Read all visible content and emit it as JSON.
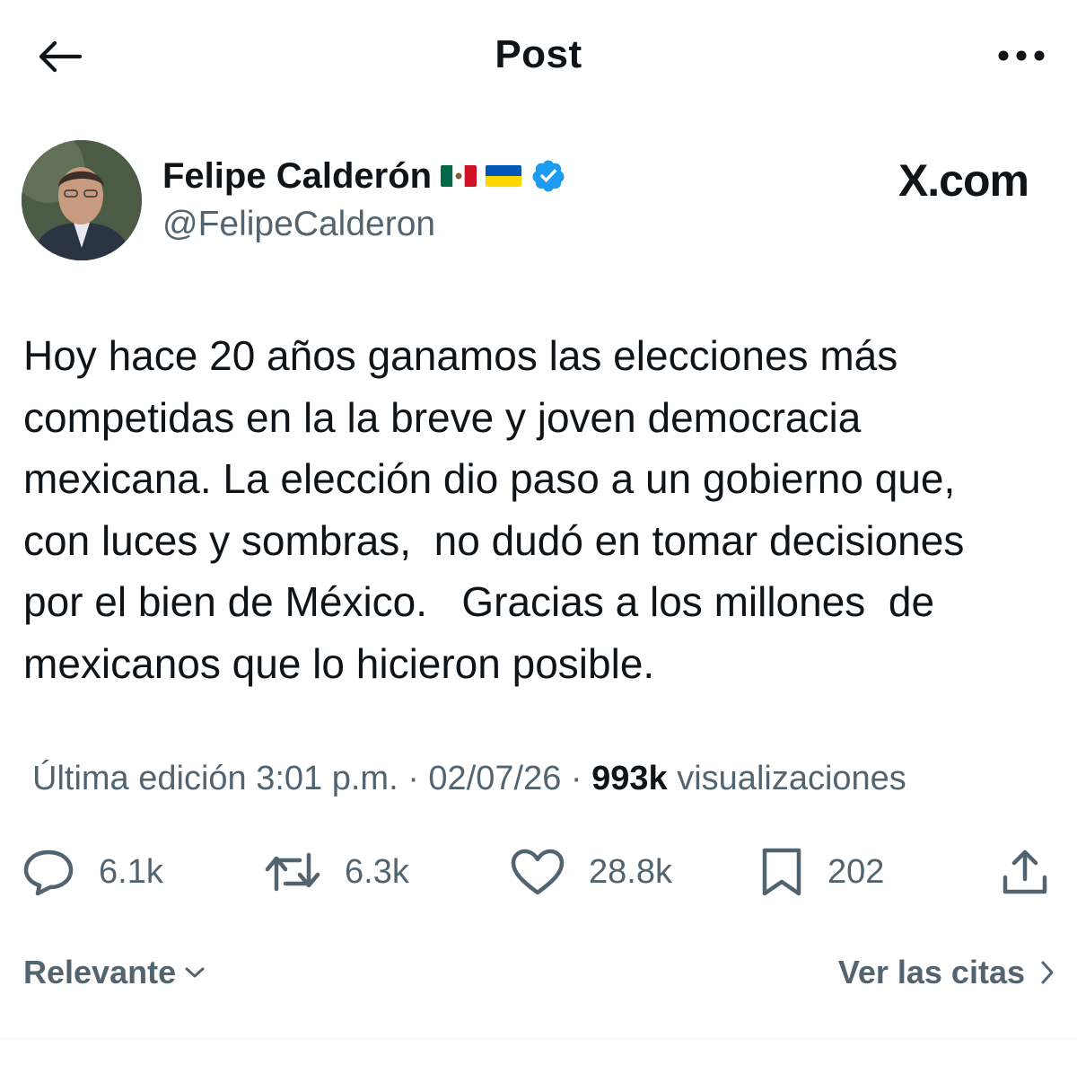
{
  "header": {
    "title": "Post",
    "back_icon": "arrow-left-icon",
    "more_icon": "more-horizontal-icon"
  },
  "author": {
    "display_name": "Felipe Calderón",
    "flags": [
      "mexico-flag",
      "ukraine-flag"
    ],
    "verified": true,
    "handle": "@FelipeCalderon",
    "source_label": "X.com"
  },
  "tweet": {
    "text": "Hoy hace 20 años ganamos las elecciones más\ncompetidas en la la breve y joven democracia\nmexicana. La elección dio paso a un gobierno que,\ncon luces y sombras,  no dudó en tomar decisiones\npor el bien de México.   Gracias a los millones  de\nmexicanos que lo hicieron posible."
  },
  "meta": {
    "edited_label": "Última edición",
    "time": "3:01 p.m.",
    "separator": "·",
    "date": "02/07/26",
    "views_count": "993k",
    "views_label": "visualizaciones"
  },
  "actions": {
    "replies": "6.1k",
    "reposts": "6.3k",
    "likes": "28.8k",
    "bookmarks": "202"
  },
  "bottom": {
    "sort_label": "Relevante",
    "quotes_label": "Ver las citas"
  },
  "colors": {
    "text": "#0f1419",
    "secondary": "#536471",
    "verified_blue": "#1d9bf0"
  }
}
